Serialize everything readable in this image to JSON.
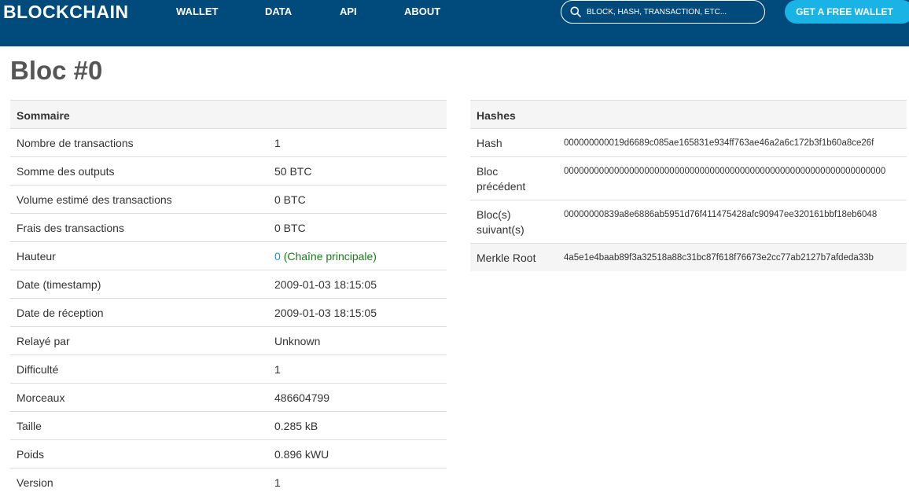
{
  "header": {
    "logo": "BLOCKCHAIN",
    "nav": [
      "WALLET",
      "DATA",
      "API",
      "ABOUT"
    ],
    "search_placeholder": "BLOCK, HASH, TRANSACTION, ETC...",
    "cta_label": "GET A FREE WALLET",
    "background_color": "#004a7c",
    "cta_color": "#1ab3e6"
  },
  "page": {
    "title": "Bloc #0"
  },
  "summary": {
    "heading": "Sommaire",
    "rows": [
      {
        "label": "Nombre de transactions",
        "value": "1"
      },
      {
        "label": "Somme des outputs",
        "value": "50 BTC"
      },
      {
        "label": "Volume estimé des transactions",
        "value": "0 BTC"
      },
      {
        "label": "Frais des transactions",
        "value": "0 BTC"
      },
      {
        "label": "Hauteur",
        "value": "0",
        "note": "(Chaîne principale)"
      },
      {
        "label": "Date (timestamp)",
        "value": "2009-01-03 18:15:05"
      },
      {
        "label": "Date de réception",
        "value": "2009-01-03 18:15:05"
      },
      {
        "label": "Relayé par",
        "value": "Unknown"
      },
      {
        "label": "Difficulté",
        "value": "1"
      },
      {
        "label": "Morceaux",
        "value": "486604799"
      },
      {
        "label": "Taille",
        "value": "0.285 kB"
      },
      {
        "label": "Poids",
        "value": "0.896 kWU"
      },
      {
        "label": "Version",
        "value": "1"
      }
    ]
  },
  "hashes": {
    "heading": "Hashes",
    "rows": [
      {
        "label": "Hash",
        "value": "000000000019d6689c085ae165831e934ff763ae46a2a6c172b3f1b60a8ce26f"
      },
      {
        "label_line1": "Bloc",
        "label_line2": "précédent",
        "value": "0000000000000000000000000000000000000000000000000000000000000000"
      },
      {
        "label_line1": "Bloc(s)",
        "label_line2": "suivant(s)",
        "value": "00000000839a8e6886ab5951d76f411475428afc90947ee320161bbf18eb6048"
      },
      {
        "label": "Merkle Root",
        "value": "4a5e1e4baab89f3a32518a88c31bc87f618f76673e2cc77ab2127b7afdeda33b"
      }
    ]
  }
}
